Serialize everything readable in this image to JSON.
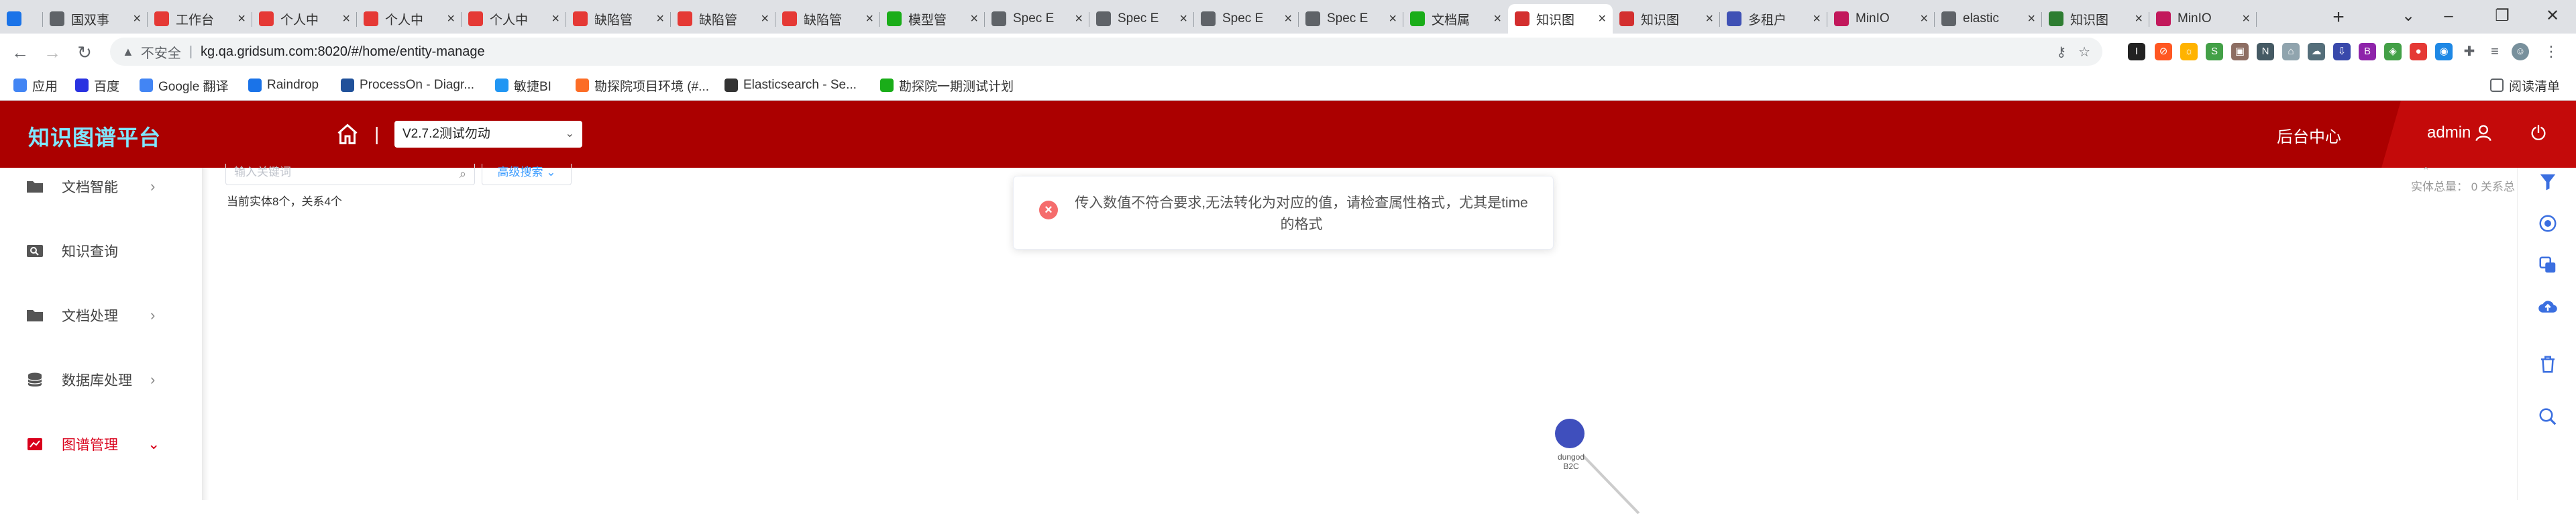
{
  "browser": {
    "tabs": [
      {
        "label": "",
        "icon": "app-icon",
        "color": "#1a73e8"
      },
      {
        "label": "国双事",
        "icon": "globe-icon",
        "color": "#5f6368"
      },
      {
        "label": "工作台",
        "icon": "gw-icon",
        "color": "#e53935"
      },
      {
        "label": "个人中",
        "icon": "gw-icon",
        "color": "#e53935"
      },
      {
        "label": "个人中",
        "icon": "gw-icon",
        "color": "#e53935"
      },
      {
        "label": "个人中",
        "icon": "gw-icon",
        "color": "#e53935"
      },
      {
        "label": "缺陷管",
        "icon": "gw-icon",
        "color": "#e53935"
      },
      {
        "label": "缺陷管",
        "icon": "gw-icon",
        "color": "#e53935"
      },
      {
        "label": "缺陷管",
        "icon": "gw-icon",
        "color": "#e53935"
      },
      {
        "label": "模型管",
        "icon": "model-icon",
        "color": "#1aad19"
      },
      {
        "label": "Spec E",
        "icon": "globe-icon",
        "color": "#5f6368"
      },
      {
        "label": "Spec E",
        "icon": "globe-icon",
        "color": "#5f6368"
      },
      {
        "label": "Spec E",
        "icon": "globe-icon",
        "color": "#5f6368"
      },
      {
        "label": "Spec E",
        "icon": "globe-icon",
        "color": "#5f6368"
      },
      {
        "label": "文档属",
        "icon": "doc-icon",
        "color": "#1aad19"
      },
      {
        "label": "知识图",
        "icon": "kg-icon",
        "color": "#d32f2f"
      },
      {
        "label": "知识图",
        "icon": "kg-icon",
        "color": "#d32f2f"
      },
      {
        "label": "多租户",
        "icon": "tenant-icon",
        "color": "#3f51b5"
      },
      {
        "label": "MinIO",
        "icon": "minio-icon",
        "color": "#c2185b"
      },
      {
        "label": "elastic",
        "icon": "globe-icon",
        "color": "#5f6368"
      },
      {
        "label": "知识图",
        "icon": "kg-v-icon",
        "color": "#2e7d32"
      },
      {
        "label": "MinIO",
        "icon": "minio-icon",
        "color": "#c2185b"
      }
    ],
    "address": {
      "insecure_label": "不安全",
      "url": "kg.qa.gridsum.com:8020/#/home/entity-manage"
    },
    "bookmarks": [
      {
        "label": "应用",
        "color": "#4285f4"
      },
      {
        "label": "百度",
        "color": "#2932e1"
      },
      {
        "label": "Google 翻译",
        "color": "#4285f4"
      },
      {
        "label": "Raindrop",
        "color": "#1a73e8"
      },
      {
        "label": "ProcessOn - Diagr...",
        "color": "#20519a"
      },
      {
        "label": "敏捷BI",
        "color": "#2196f3"
      },
      {
        "label": "勘探院项目环境 (#...",
        "color": "#fc6d26"
      },
      {
        "label": "Elasticsearch - Se...",
        "color": "#333333"
      },
      {
        "label": "勘探院一期测试计划",
        "color": "#1aad19"
      }
    ],
    "reading_list": "阅读清单"
  },
  "header": {
    "logo": "知识图谱平台",
    "project": "V2.7.2测试勿动",
    "backend": "后台中心",
    "user": "admin"
  },
  "sidebar": {
    "items": [
      {
        "label": "文档智能",
        "icon": "folder-icon",
        "has_arrow": true,
        "arrow": "›",
        "active": false
      },
      {
        "label": "知识查询",
        "icon": "search-card-icon",
        "has_arrow": false,
        "arrow": "",
        "active": false
      },
      {
        "label": "文档处理",
        "icon": "folder-icon",
        "has_arrow": true,
        "arrow": "›",
        "active": false
      },
      {
        "label": "数据库处理",
        "icon": "database-icon",
        "has_arrow": true,
        "arrow": "›",
        "active": false
      },
      {
        "label": "图谱管理",
        "icon": "graph-icon",
        "has_arrow": true,
        "arrow": "⌄",
        "active": true
      }
    ]
  },
  "main": {
    "search_placeholder": "输入关键词",
    "advanced_search": "高级搜索",
    "counts": "当前实体8个，关系4个",
    "right_counts": "实体总量：",
    "right_counts_more": "0 关系总",
    "toast": {
      "type": "error",
      "message": "传入数值不符合要求,无法转化为对应的值，请检查属性格式，尤其是time的格式"
    },
    "graph_node": {
      "label_line1": "dungod",
      "label_line2": "B2C",
      "color": "#3f4fbd"
    }
  },
  "colors": {
    "header_bg": "#ab0000",
    "logo_text": "#7fe7ff",
    "active_menu": "#d9001b",
    "tool_blue": "#3b6fe0"
  },
  "righttools": [
    "filter-icon",
    "target-icon",
    "copy-icon",
    "cloud-upload-icon",
    "trash-icon",
    "search-icon"
  ]
}
